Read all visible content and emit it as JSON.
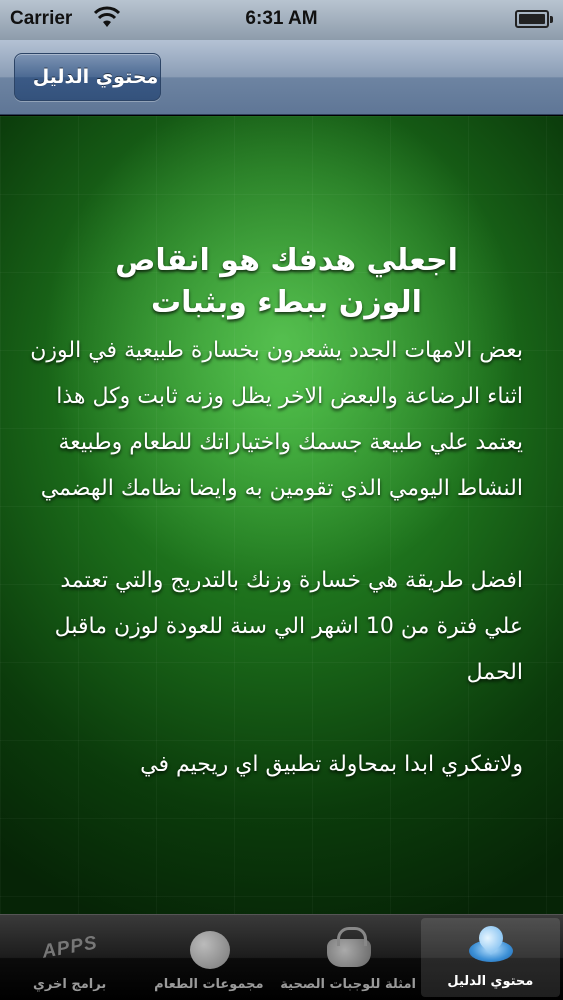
{
  "status_bar": {
    "carrier": "Carrier",
    "time": "6:31 AM"
  },
  "nav_bar": {
    "back_label": "محتوي الدليل"
  },
  "article": {
    "title": "اجعلي هدفك هو انقاص الوزن ببطء وبثبات",
    "paragraphs": [
      "بعض الامهات الجدد يشعرون بخسارة طبيعية في الوزن اثناء الرضاعة والبعض الاخر يظل وزنه ثابت وكل هذا يعتمد علي طبيعة جسمك واختياراتك للطعام وطبيعة النشاط اليومي الذي تقومين به وايضا نظامك الهضمي",
      "افضل طريقة هي خسارة وزنك بالتدريج والتي تعتمد علي فترة من 10 اشهر الي سنة للعودة لوزن ماقبل الحمل",
      "ولاتفكري ابدا بمحاولة تطبيق اي ريجيم في"
    ]
  },
  "tab_bar": {
    "tabs": [
      {
        "label": "برامج اخري",
        "icon": "apps-icon",
        "icon_text": "APPS"
      },
      {
        "label": "مجموعات الطعام",
        "icon": "apple-icon"
      },
      {
        "label": "امثلة للوجبات الصحية",
        "icon": "basket-icon"
      },
      {
        "label": "محتوي الدليل",
        "icon": "water-drop-icon",
        "selected": true
      }
    ]
  },
  "colors": {
    "nav_blue": "#5f7696",
    "content_green": "#2e9a2c",
    "tab_bar_black": "#000000"
  }
}
